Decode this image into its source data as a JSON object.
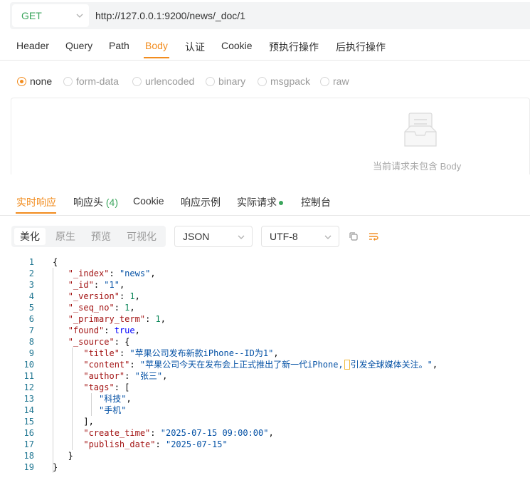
{
  "request": {
    "method": "GET",
    "url": "http://127.0.0.1:9200/news/_doc/1"
  },
  "request_tabs": [
    "Header",
    "Query",
    "Path",
    "Body",
    "认证",
    "Cookie",
    "预执行操作",
    "后执行操作"
  ],
  "request_active_tab": "Body",
  "body_types": [
    {
      "label": "none",
      "checked": true
    },
    {
      "label": "form-data",
      "checked": false
    },
    {
      "label": "urlencoded",
      "checked": false
    },
    {
      "label": "binary",
      "checked": false
    },
    {
      "label": "msgpack",
      "checked": false
    },
    {
      "label": "raw",
      "checked": false
    }
  ],
  "empty_body_text": "当前请求未包含 Body",
  "response_tabs": {
    "realtime": "实时响应",
    "headers": "响应头",
    "headers_count": "(4)",
    "cookie": "Cookie",
    "example": "响应示例",
    "actual": "实际请求",
    "console": "控制台"
  },
  "view_modes": [
    "美化",
    "原生",
    "预览",
    "可视化"
  ],
  "active_view_mode": "美化",
  "format_select": "JSON",
  "encoding_select": "UTF-8",
  "colors": {
    "accent": "#f28c1e",
    "method": "#3ba55c",
    "status_dot": "#3ba55c"
  },
  "response_body": {
    "_index": "news",
    "_id": "1",
    "_version": 1,
    "_seq_no": 1,
    "_primary_term": 1,
    "found": true,
    "source_title": "苹果公司发布新款iPhone--ID为1",
    "source_content_before_cursor": "苹果公司今天在发布会上正式推出了新一代iPhone,",
    "source_content_after_cursor": "引发全球媒体关注。",
    "source_author": "张三",
    "source_tags": [
      "科技",
      "手机"
    ],
    "source_create_time": "2025-07-15 09:00:00",
    "source_publish_date": "2025-07-15"
  },
  "line_numbers": [
    "1",
    "2",
    "3",
    "4",
    "5",
    "6",
    "7",
    "8",
    "9",
    "10",
    "11",
    "12",
    "13",
    "14",
    "15",
    "16",
    "17",
    "18",
    "19"
  ]
}
